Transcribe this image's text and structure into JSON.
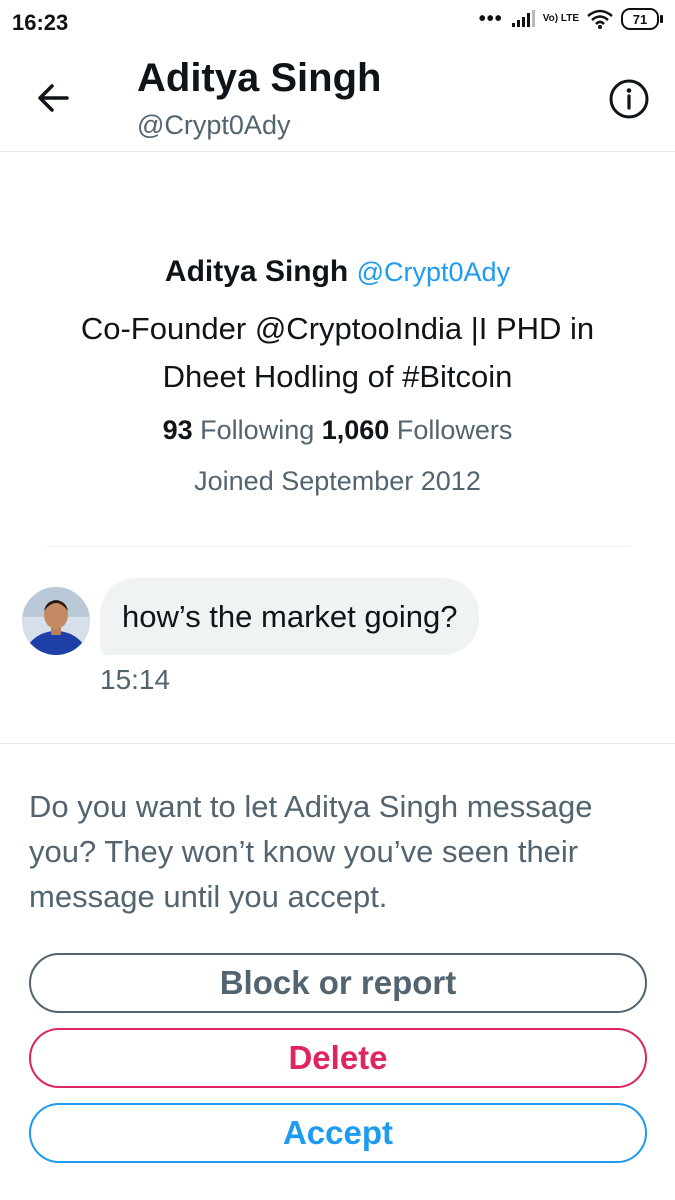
{
  "status_bar": {
    "time": "16:23",
    "dots": "•••",
    "network": "Vo) LTE",
    "battery": "71",
    "icons": [
      "signal-icon",
      "volte-icon",
      "wifi-icon",
      "battery-icon"
    ]
  },
  "header": {
    "title": "Aditya Singh",
    "handle": "@Crypt0Ady",
    "back_icon": "arrow-left-icon",
    "info_icon": "info-icon"
  },
  "profile": {
    "name": "Aditya Singh",
    "handle": "@Crypt0Ady",
    "bio_line1": "Co-Founder @CryptooIndia |I PHD in",
    "bio_line2": "Dheet Hodling of #Bitcoin",
    "following_count": "93",
    "following_label": "Following",
    "followers_count": "1,060",
    "followers_label": "Followers",
    "joined": "Joined September 2012"
  },
  "message": {
    "text": "how’s the market going?",
    "time": "15:14"
  },
  "request": {
    "prompt": "Do you want to let Aditya Singh message you? They won’t know you’ve seen their message until you accept.",
    "block_label": "Block or report",
    "delete_label": "Delete",
    "accept_label": "Accept"
  },
  "colors": {
    "accent": "#1d9bf0",
    "danger": "#e0245e",
    "secondary_text": "#536471",
    "primary_text": "#0f1419"
  }
}
